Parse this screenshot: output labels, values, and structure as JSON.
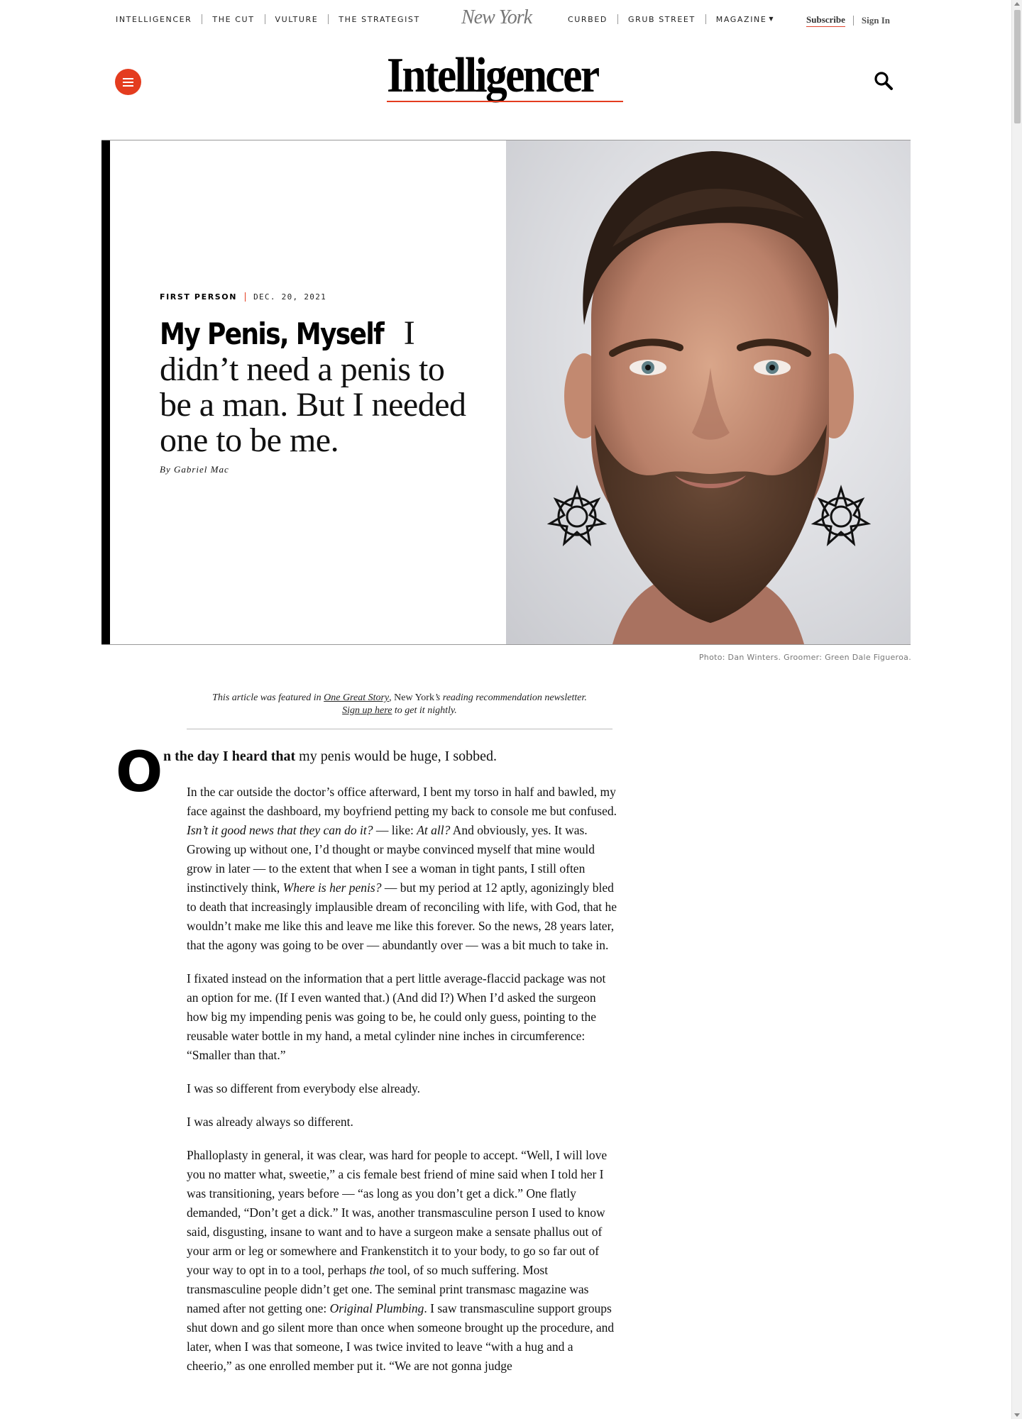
{
  "topnav": {
    "left_links": [
      "INTELLIGENCER",
      "THE CUT",
      "VULTURE",
      "THE STRATEGIST"
    ],
    "logo": "New York",
    "right_links": [
      "CURBED",
      "GRUB STREET",
      "MAGAZINE"
    ],
    "subscribe": "Subscribe",
    "signin": "Sign In"
  },
  "brand": {
    "name": "Intelligencer",
    "accent_color": "#e43c1f"
  },
  "hero": {
    "rubric": "FIRST PERSON",
    "date": "DEC. 20, 2021",
    "title": "My Penis, Myself",
    "dek": "I didn’t need a penis to be a man. But I needed one to be me.",
    "byline_prefix": "By",
    "author": "Gabriel Mac",
    "photo_credit": "Photo: Dan Winters. Groomer: Green Dale Figueroa."
  },
  "newsletter": {
    "lead": "This article was featured in",
    "link1": "One Great Story",
    "mid": ", New York",
    "mid2": "’s reading recommendation newsletter.",
    "link2": "Sign up here",
    "tail": "to get it nightly."
  },
  "article": {
    "dropcap": "O",
    "lede_bold": "n the day I heard that",
    "lede_rest": " my penis would be huge, I sobbed.",
    "p1_a": "In the car outside the doctor’s office afterward, I bent my torso in half and bawled, my face against the dashboard, my boyfriend petting my back to console me but confused. ",
    "p1_i1": "Isn’t it good news that they can do it?",
    "p1_b": " — like: ",
    "p1_i2": "At all?",
    "p1_c": " And obviously, yes. It was. Growing up without one, I’d thought or maybe convinced myself that mine would grow in later — to the extent that when I see a woman in tight pants, I still often instinctively think, ",
    "p1_i3": "Where is her penis?",
    "p1_d": " — but my period at 12 aptly, agonizingly bled to death that increasingly implausible dream of reconciling with life, with God, that he wouldn’t make me like this and leave me like this forever. So the news, 28 years later, that the agony was going to be over — abundantly over — was a bit much to take in.",
    "p2": "I fixated instead on the information that a pert little average-flaccid package was not an option for me. (If I even wanted that.) (And did I?) When I’d asked the surgeon how big my impending penis was going to be, he could only guess, pointing to the reusable water bottle in my hand, a metal cylinder nine inches in circumference: “Smaller than that.”",
    "p3": "I was so different from everybody else already.",
    "p4": "I was already always so different.",
    "p5_a": "Phalloplasty in general, it was clear, was hard for people to accept. “Well, I will love you no matter what, sweetie,” a cis female best friend of mine said when I told her I was transitioning, years before — “as long as you don’t get a dick.” One flatly demanded, “Don’t get a dick.” It was, another transmasculine person I used to know said, disgusting, insane to want and to have a surgeon make a sensate phallus out of your arm or leg or somewhere and Frankenstitch it to your body, to go so far out of your way to opt in to a tool, perhaps ",
    "p5_i1": "the",
    "p5_b": " tool, of so much suffering. Most transmasculine people didn’t get one. The seminal print transmasc magazine was named after not getting one: ",
    "p5_i2": "Original Plumbing",
    "p5_c": ". I saw transmasculine support groups shut down and go silent more than once when someone brought up the procedure, and later, when I was that someone, I was twice invited to leave “with a hug and a cheerio,” as one enrolled member put it. “We are not gonna judge"
  }
}
